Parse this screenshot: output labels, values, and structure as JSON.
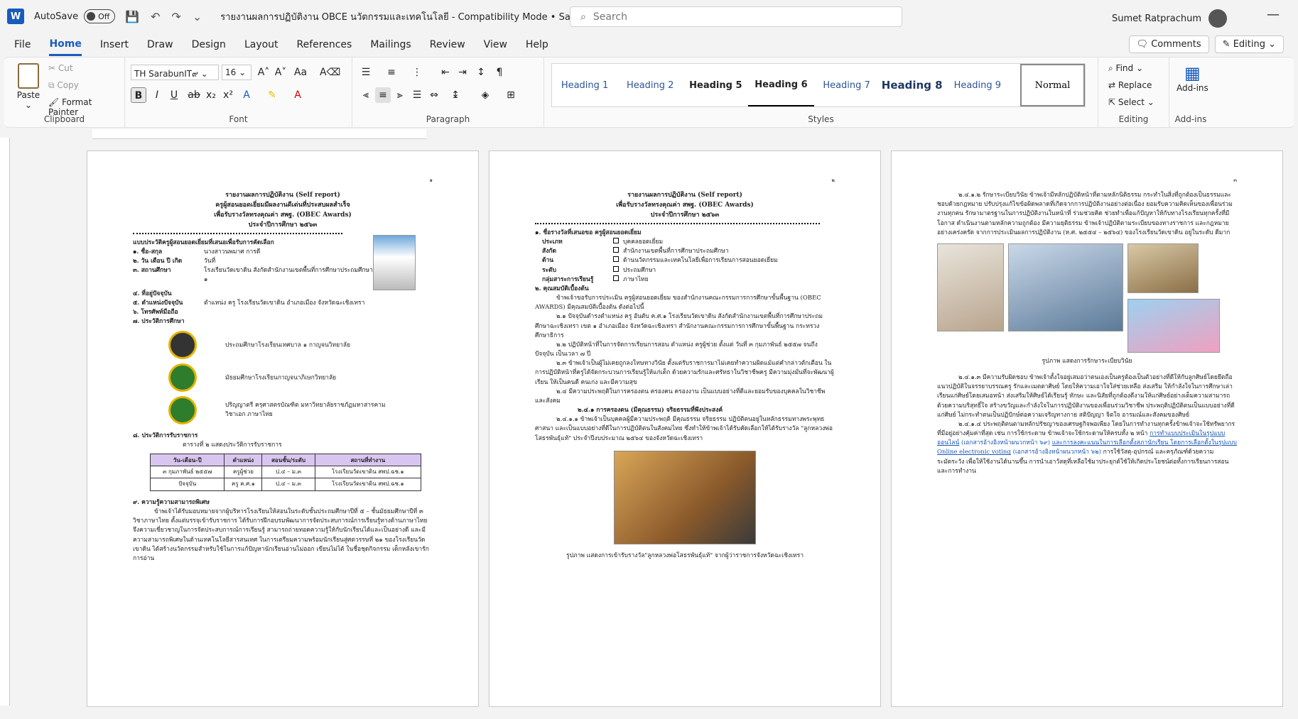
{
  "titlebar": {
    "autosave_label": "AutoSave",
    "autosave_state": "Off",
    "document_title": "รายงานผลการปฏิบัติงาน OBCE นวัตกรรมและเทคโนโลยี",
    "mode": "Compatibility Mode",
    "save_state": "Saved",
    "search_placeholder": "Search",
    "user_name": "Sumet Ratprachum"
  },
  "menu": {
    "items": [
      "File",
      "Home",
      "Insert",
      "Draw",
      "Design",
      "Layout",
      "References",
      "Mailings",
      "Review",
      "View",
      "Help"
    ],
    "comments_label": "Comments",
    "editing_label": "Editing"
  },
  "ribbon": {
    "clipboard": {
      "paste": "Paste",
      "cut": "Cut",
      "copy": "Copy",
      "format_painter": "Format Painter",
      "group_label": "Clipboard"
    },
    "font": {
      "name": "TH SarabunIT๙",
      "size": "16",
      "group_label": "Font"
    },
    "paragraph": {
      "group_label": "Paragraph"
    },
    "styles": {
      "items": [
        "Heading 1",
        "Heading 2",
        "Heading 5",
        "Heading 6",
        "Heading 7",
        "Heading 8",
        "Heading 9",
        "Normal"
      ],
      "group_label": "Styles"
    },
    "editing": {
      "find": "Find",
      "replace": "Replace",
      "select": "Select",
      "group_label": "Editing"
    },
    "addins": {
      "label": "Add-ins",
      "group_label": "Add-ins"
    }
  },
  "page1": {
    "page_number": "๑",
    "title1": "รายงานผลการปฏิบัติงาน (Self report)",
    "title2": "ครูผู้สอนยอดเยี่ยมมีผลงานดีเด่นที่ประสบผลสำเร็จ",
    "title3": "เพื่อรับรางวัลทรงคุณค่า สพฐ. (OBEC Awards)",
    "title4": "ประจำปีการศึกษา ๒๕๖๓",
    "form_title": "แบบประวัติครูผู้สอนยอดเยี่ยมที่เสนอเพื่อรับการคัดเลือก",
    "fields": [
      {
        "label": "๑. ชื่อ-สกุล",
        "value": "นางสาวนพมาศ การดี"
      },
      {
        "label": "๒. วัน เดือน ปี เกิด",
        "value": "วันที่"
      },
      {
        "label": "๓. สถานศึกษา",
        "value": "โรงเรียนวัดเขาดิน สังกัดสำนักงานเขตพื้นที่การศึกษาประถมศึกษาฉะเชิงเทรา เขต ๑"
      },
      {
        "label": "๔. ที่อยู่ปัจจุบัน",
        "value": ""
      },
      {
        "label": "๕. ตำแหน่งปัจจุบัน",
        "value": "ตำแหน่ง ครู โรงเรียนวัดเขาดิน อำเภอเมือง จังหวัดฉะเชิงเทรา"
      },
      {
        "label": "๖. โทรศัพท์มือถือ",
        "value": ""
      },
      {
        "label": "๗. ประวัติการศึกษา",
        "value": ""
      }
    ],
    "education": [
      "ประถมศึกษาโรงเรียนเทศบาล ๑ กาญจนวิทยาลัย",
      "มัธยมศึกษาโรงเรียนกาญจนาภิเษกวิทยาลัย",
      "ปริญญาตรี ครุศาสตรบัณฑิต มหาวิทยาลัยราชภัฏมหาสารคาม วิชาเอก ภาษาไทย"
    ],
    "service_heading": "๘. ประวัติการรับราชการ",
    "table_caption": "ตารางที่ ๒ แสดงประวัติการรับราชการ",
    "table_headers": [
      "วัน-เดือน-ปี",
      "ตำแหน่ง",
      "สอนชั้น/ระดับ",
      "สถานที่ทำงาน"
    ],
    "table_rows": [
      [
        "๓ กุมภาพันธ์ ๒๕๕๗",
        "ครูผู้ช่วย",
        "ป.๔ – ม.๓",
        "โรงเรียนวัดเขาดิน สพป.ฉช.๑"
      ],
      [
        "ปัจจุบัน",
        "ครู ค.ศ.๑",
        "ป.๔ – ม.๓",
        "โรงเรียนวัดเขาดิน สพป.ฉช.๑"
      ]
    ],
    "skills_heading": "๙. ความรู้ความสามารถพิเศษ",
    "skills_text": "ข้าพเจ้าได้รับมอบหมายจากผู้บริหารโรงเรียนให้สอนในระดับชั้นประถมศึกษาปีที่ ๕ – ชั้นมัธยมศึกษาปีที่ ๓ วิชาภาษาไทย ตั้งแต่บรรจุเข้ารับราชการ ได้รับการฝึกอบรมพัฒนาการจัดประสบการณ์การเรียนรู้ทางด้านภาษาไทย จึงความเชี่ยวชาญในการจัดประสบการณ์การเรียนรู้ สามารถถ่ายทอดความรู้ให้กับนักเรียนได้และเป็นอย่างดี และมีความสามารถพิเศษในด้านเทคโนโลยีสารสนเทศ ในการเตรียมความพร้อมนักเรียนสู่ศตวรรษที่ ๒๑ ของโรงเรียนวัดเขาดิน ได้สร้างนวัตกรรมสำหรับใช้ในการแก้ปัญหานักเรียนอ่านไม่ออก เขียนไม่ได้ ในชื่อชุดกิจกรรม เด็กหลังเขารักการอ่าน"
  },
  "page2": {
    "page_number": "๒",
    "title1": "รายงานผลการปฏิบัติงาน (Self report)",
    "title2": "เพื่อรับรางวัลทรงคุณค่า สพฐ. (OBEC Awards)",
    "title3": "ประจำปีการศึกษา ๒๕๖๓",
    "award_heading": "๑. ชื่อรางวัลที่เสนอขอ ครูผู้สอนยอดเยี่ยม",
    "checks": [
      {
        "label": "ประเภท",
        "value": "บุคคลยอดเยี่ยม"
      },
      {
        "label": "สังกัด",
        "value": "สำนักงานเขตพื้นที่การศึกษาประถมศึกษา"
      },
      {
        "label": "ด้าน",
        "value": "ด้านนวัตกรรมและเทคโนโลยีเพื่อการเรียนการสอนยอดเยี่ยม"
      },
      {
        "label": "ระดับ",
        "value": "ประถมศึกษา"
      },
      {
        "label": "กลุ่มสาระการเรียนรู้",
        "value": "ภาษาไทย"
      }
    ],
    "qual_heading": "๒. คุณสมบัติเบื้องต้น",
    "paragraphs": [
      "ข้าพเจ้าขอรับการประเมิน ครูผู้สอนยอดเยี่ยม ของสำนักงานคณะกรรมการการศึกษาขั้นพื้นฐาน (OBEC AWARDS) มีคุณสมบัติเบื้องต้น ดังต่อไปนี้",
      "๒.๑ ปัจจุบันดำรงตำแหน่ง ครู อันดับ ค.ศ.๑ โรงเรียนวัดเขาดิน สังกัดสำนักงานเขตพื้นที่การศึกษาประถมศึกษาฉะเชิงเทรา เขต ๑ อำเภอเมือง จังหวัดฉะเชิงเทรา สำนักงานคณะกรรมการการศึกษาขั้นพื้นฐาน กระทรวงศึกษาธิการ",
      "๒.๒ ปฏิบัติหน้าที่ในการจัดการเรียนการสอน ตำแหน่ง ครูผู้ช่วย ตั้งแต่ วันที่ ๓ กุมภาพันธ์ ๒๕๕๗ จนถึงปัจจุบัน เป็นเวลา ๗ ปี",
      "๒.๓ ข้าพเจ้าเป็นผู้ไม่เคยถูกลงโทษทางวินัย ตั้งแต่รับราชการมาไม่เคยทำความผิดแม้แต่คำกล่าวตักเตือน ในการปฏิบัติหน้าที่ครูได้จัดกระบวนการเรียนรู้ให้แก่เด็ก ด้วยความรักและศรัทธาในวิชาชีพครู มีความมุ่งมั่นที่จะพัฒนาผู้เรียน ให้เป็นคนดี คนเก่ง และมีความสุข",
      "๒.๔ มีความประพฤติในการครองตน ครองคน ครองงาน เป็นแบบอย่างที่ดีและยอมรับของบุคคลในวิชาชีพและสังคม",
      "๒.๔.๑ การครองตน (มีคุณธรรม) จริยธรรมที่พึงประสงค์",
      "๒.๔.๑.๑ ข้าพเจ้าเป็นบุคคลผู้มีความประพฤติ มีคุณธรรม จริยธรรม ปฏิบัติตนอยู่ในหลักธรรมทางพระพุทธศาสนา และเป็นแบบอย่างที่ดีในการปฏิบัติตนในสังคมไทย ซึ่งทำให้ข้าพเจ้าได้รับคัดเลือกให้ได้รับรางวัล \"ลูกหลวงพ่อโสธรพันธุ์แท้\" ประจำปีงบประมาณ ๒๕๖๔ ของจังหวัดฉะเชิงเทรา"
    ],
    "photo_caption": "รูปภาพ แสดงการเข้ารับรางวัล\"ลูกหลวงพ่อโสธรพันธุ์แท้\" จากผู้ว่าราชการจังหวัดฉะเชิงเทรา"
  },
  "page3": {
    "page_number": "๓",
    "para1": "๒.๔.๑.๒ รักษาระเบียบวินัย ข้าพเจ้ามีหลักปฏิบัติหน้าที่ตามหลักนิติธรรม กระทำในสิ่งที่ถูกต้องเป็นธรรมและชอบด้วยกฎหมาย ปรับปรุงแก้ไขข้อผิดพลาดที่เกิดจากการปฏิบัติงานอย่างต่อเนื่อง ยอมรับความคิดเห็นของเพื่อนร่วมงานทุกคน รักษามาตรฐานในการปฏิบัติงานในหน้าที่ ร่วมช่วยคิด ช่วยทำเพื่อแก้ปัญหาให้กับทางโรงเรียนทุกครั้งที่มีโอกาส ดำเนินงานตามหลักความถูกต้อง มีความยุติธรรม ข้าพเจ้าปฏิบัติตามระเบียบของทางราชการ และกฎหมายอย่างเคร่งครัด จากการประเมินผลการปฏิบัติงาน (ห.ศ. ๒๕๕๔ – ๒๕๖๔) ของโรงเรียนวัดเขาดิน อยู่ในระดับ ดีมาก",
    "gallery_caption": "รูปภาพ แสดงการรักษาระเบียบวินัย",
    "para2": "๒.๔.๑.๓ มีความรับผิดชอบ ข้าพเจ้าตั้งใจอยู่เสมอว่าตนเองเป็นครูต้องเป็นตัวอย่างที่ดีให้กับลูกศิษย์โดยยึดถือแนวปฏิบัติในจรรยาบรรณครู รักและเมตตาศิษย์ โดยให้ความเอาใจใส่ช่วยเหลือ ส่งเสริม ให้กำลังใจในการศึกษาเล่าเรียนแก่ศิษย์โดยเสมอหน้า ส่งเสริมให้ศิษย์ได้เรียนรู้ ทักษะ และนิสัยที่ถูกต้องดีงามให้แก่ศิษย์อย่างเต็มความสามารถ ด้วยความบริสุทธิ์ใจ สร้างขวัญและกำลังใจในการปฏิบัติงานของเพื่อนร่วมวิชาชีพ ประพฤติปฏิบัติตนเป็นแบบอย่างที่ดีแก่ศิษย์ ไม่กระทำตนเป็นปฏิปักษ์ต่อความเจริญทางกาย สติปัญญา จิตใจ อารมณ์และสังคมของศิษย์",
    "para3": "๒.๔.๑.๔ ประพฤติตนตามหลักปรัชญาของเศรษฐกิจพอเพียง โดยในการทำงานทุกครั้งข้าพเจ้าจะใช้ทรัพยากรที่มีอยู่อย่างคุ้มค่าที่สุด เช่น การใช้กระดาษ ข้าพเจ้าจะใช้กระดาษให้ครบทั้ง ๒ หน้า",
    "link1": "การทำแบบประเมินในรูปแบบออนไลน์",
    "link1_note": "(เอกสารอ้างอิงหน้าผนวกหน้า ๖๙)",
    "link2": "และการลงคะแนนในการเลือกตั้งสภานักเรียน โดยการเลือกตั้งในรูปแบบ Online electronic voting",
    "link2_note": "(เอกสารอ้างอิงหน้าผนวกหน้า ๖๒)",
    "para4": "การใช้วัสดุ-อุปกรณ์ และครุภัณฑ์ด้วยความระมัดระวัง เพื่อให้ใช้งานได้นานขึ้น การนำเอาวัสดุที่เหลือใช้มาประยุกต์ใช้ให้เกิดประโยชน์ต่อทั้งการเรียนการสอน และการทำงาน"
  }
}
